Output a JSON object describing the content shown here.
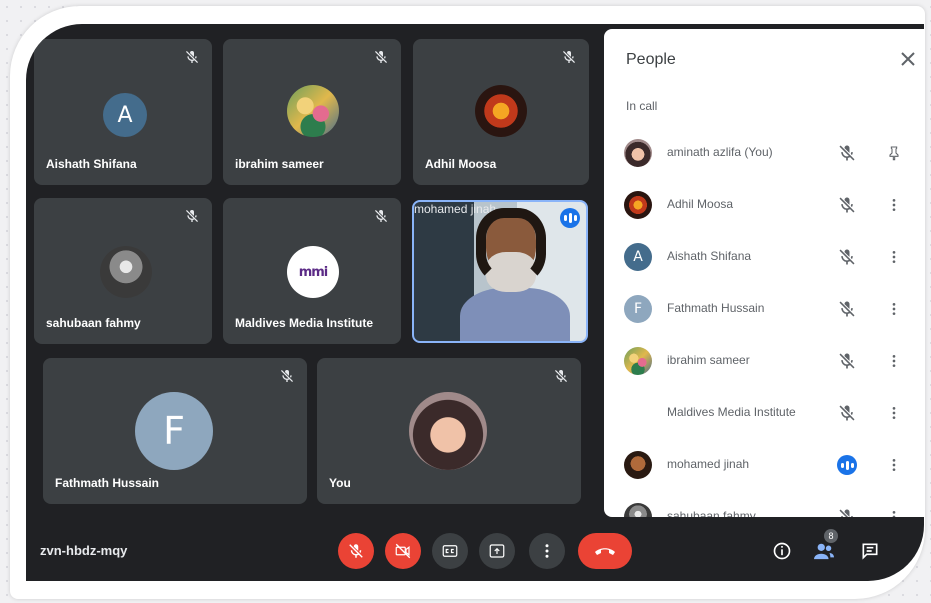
{
  "meeting": {
    "code": "zvn-hbdz-mqy"
  },
  "tiles": {
    "aishath": {
      "name": "Aishath Shifana",
      "initial": "A"
    },
    "ibrahim": {
      "name": "ibrahim sameer"
    },
    "adhil": {
      "name": "Adhil Moosa"
    },
    "sahubaan": {
      "name": "sahubaan fahmy"
    },
    "mmi": {
      "name": "Maldives Media Institute",
      "logo_text": "mmi"
    },
    "jinah": {
      "name": "mohamed jinah"
    },
    "fathmath": {
      "name": "Fathmath Hussain",
      "initial": "F"
    },
    "you": {
      "name": "You"
    }
  },
  "people_panel": {
    "title": "People",
    "section": "In call",
    "participants": [
      {
        "name": "aminath azlifa (You)"
      },
      {
        "name": "Adhil Moosa"
      },
      {
        "name": "Aishath Shifana",
        "initial": "A"
      },
      {
        "name": "Fathmath Hussain",
        "initial": "F"
      },
      {
        "name": "ibrahim sameer"
      },
      {
        "name": "Maldives Media Institute",
        "logo_text": "mmi"
      },
      {
        "name": "mohamed jinah"
      },
      {
        "name": "sahubaan fahmy"
      }
    ]
  },
  "controls": {
    "people_count": "8"
  },
  "colors": {
    "accent_blue": "#1a73e8",
    "danger_red": "#ea4335",
    "tile_bg": "#3c4043",
    "meet_bg": "#202124",
    "avatar_a": "#446c8c",
    "avatar_f": "#8ea7be"
  },
  "icons": {
    "muted_mic": "mic-off-icon",
    "pin": "pin-icon",
    "more": "more-vert-icon",
    "close": "close-icon",
    "captions": "captions-icon",
    "present": "present-icon",
    "end_call": "phone-hangup-icon",
    "info": "info-icon",
    "people": "people-icon",
    "chat": "chat-icon"
  }
}
